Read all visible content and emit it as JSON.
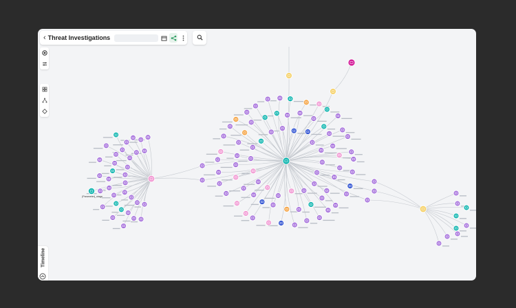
{
  "app": {
    "title": "Threat Investigations",
    "title_field": ""
  },
  "toolbar": {
    "back_glyph": "‹",
    "icons": [
      "calendar-icon",
      "share-icon",
      "more-vert-icon"
    ],
    "search_icon": "search-icon"
  },
  "left_rail": {
    "top_group": [
      "target-icon",
      "filter-sliders-icon"
    ],
    "bottom_group": [
      "grid-icon",
      "hierarchy-icon",
      "diamond-icon"
    ]
  },
  "timeline": {
    "label": "Timeline",
    "icon": "expand-up-icon"
  },
  "graph": {
    "hubs": [
      {
        "id": "hub-left",
        "kind": "pink"
      },
      {
        "id": "hub-center",
        "kind": "teal"
      },
      {
        "id": "hub-right",
        "kind": "yellow"
      },
      {
        "id": "hub-top",
        "kind": "magenta"
      }
    ],
    "labelled_node": "(Parameter)_stage",
    "colors": {
      "purple": "#a874dd",
      "teal": "#12b6b0",
      "blue": "#3557d3",
      "orange": "#f5a547",
      "pink": "#f29bd4",
      "yellow": "#f6d26b",
      "magenta": "#d41f9b",
      "edge": "#c4c8ce"
    }
  }
}
